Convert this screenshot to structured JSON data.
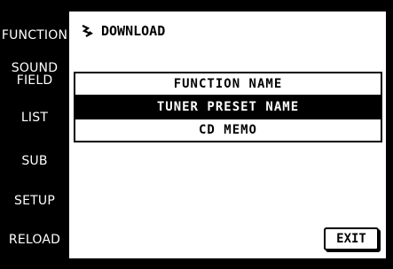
{
  "sidebar": {
    "items": [
      {
        "label": "FUNCTION"
      },
      {
        "label_line1": "SOUND",
        "label_line2": "FIELD"
      },
      {
        "label": "LIST"
      },
      {
        "label": "SUB"
      },
      {
        "label": "SETUP"
      },
      {
        "label": "RELOAD"
      }
    ]
  },
  "header": {
    "icon": "download-icon",
    "title": "DOWNLOAD"
  },
  "list": {
    "items": [
      {
        "label": "FUNCTION NAME",
        "selected": false
      },
      {
        "label": "TUNER PRESET NAME",
        "selected": true
      },
      {
        "label": "CD MEMO",
        "selected": false
      }
    ]
  },
  "exit_button": {
    "label": "EXIT"
  },
  "colors": {
    "background": "#000000",
    "panel": "#ffffff",
    "selected_row": "#000000",
    "text_light": "#ffffff",
    "text_dark": "#000000"
  }
}
